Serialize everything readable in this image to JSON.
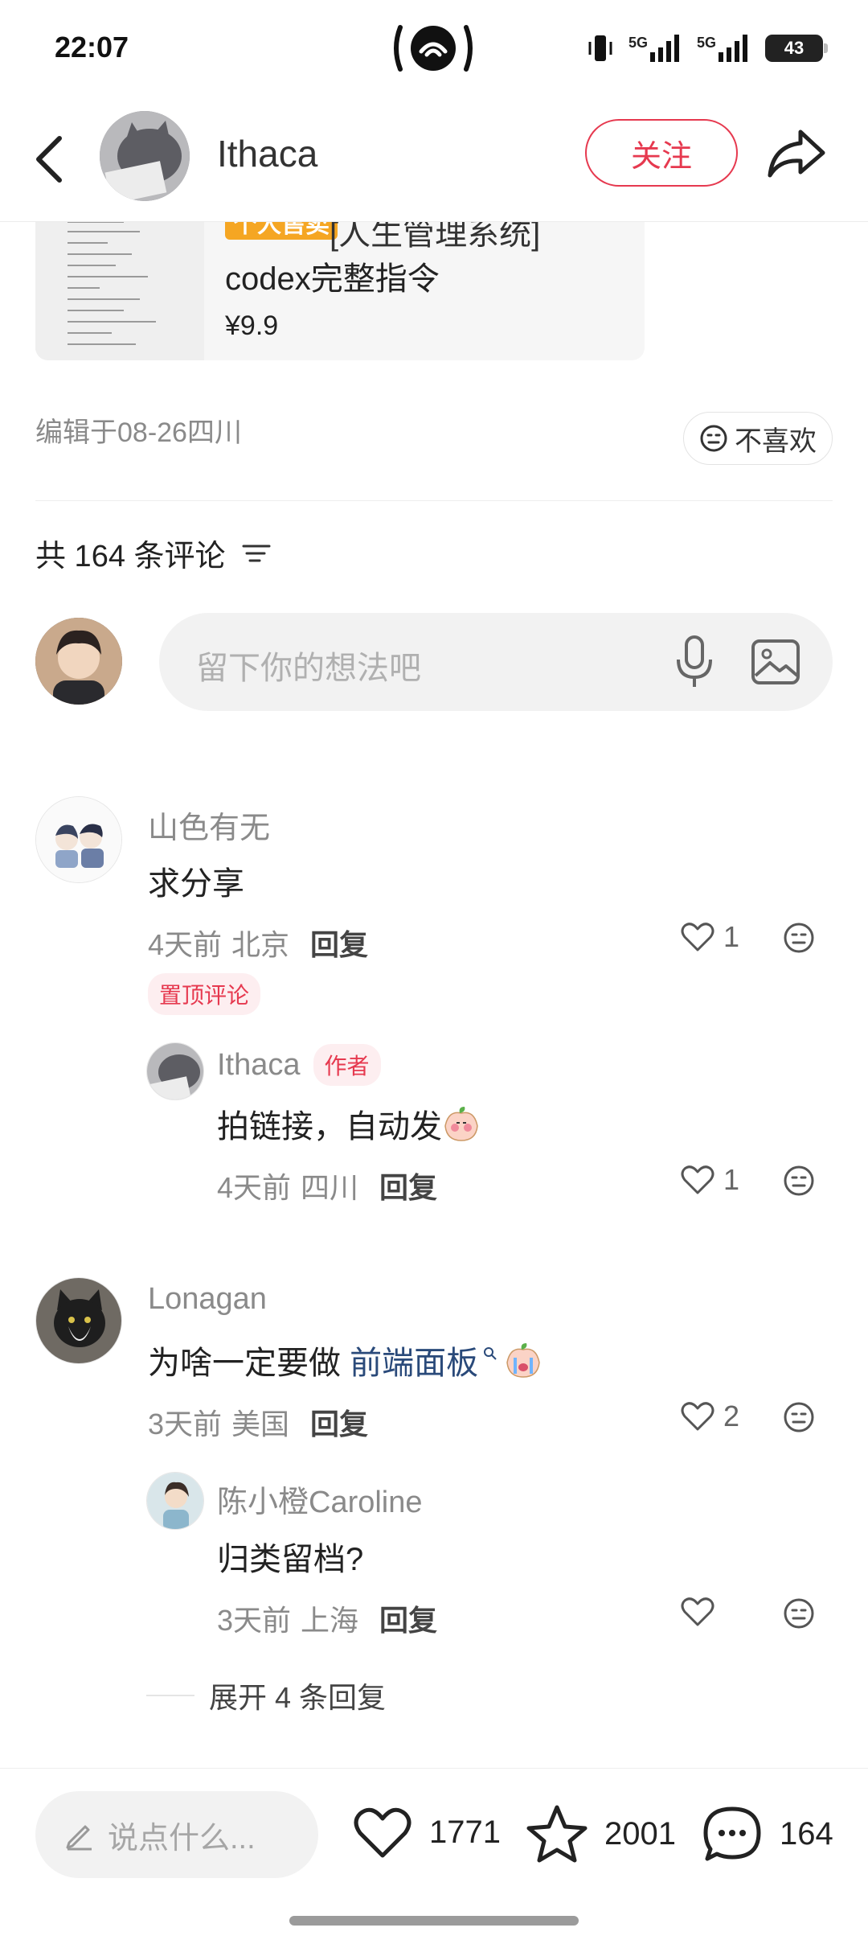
{
  "status_bar": {
    "time": "22:07",
    "network_1": "5G",
    "network_2": "5G",
    "battery": "43"
  },
  "header": {
    "author_name": "Ithaca",
    "follow_label": "关注",
    "icons": [
      "back-arrow-icon",
      "share-icon"
    ]
  },
  "product": {
    "badge": "个人售卖",
    "title_line1": "[人生管理系统]",
    "title_line2": "codex完整指令",
    "price": "¥9.9"
  },
  "post_meta": {
    "edited": "编辑于08-26四川",
    "dislike_label": "不喜欢"
  },
  "comments_section": {
    "count_label": "共 164 条评论",
    "input_placeholder": "留下你的想法吧"
  },
  "comments": [
    {
      "name": "山色有无",
      "text": "求分享",
      "time": "4天前",
      "location": "北京",
      "reply_label": "回复",
      "likes": "1",
      "pinned_label": "置顶评论",
      "replies": [
        {
          "name": "Ithaca",
          "author_badge": "作者",
          "text": "拍链接，自动发",
          "time": "4天前",
          "location": "四川",
          "reply_label": "回复",
          "likes": "1"
        }
      ]
    },
    {
      "name": "Lonagan",
      "text_prefix": "为啥一定要做 ",
      "link_text": "前端面板",
      "time": "3天前",
      "location": "美国",
      "reply_label": "回复",
      "likes": "2",
      "replies": [
        {
          "name": "陈小橙Caroline",
          "text": "归类留档?",
          "time": "3天前",
          "location": "上海",
          "reply_label": "回复",
          "likes": ""
        }
      ],
      "expand_label": "展开 4 条回复"
    }
  ],
  "bottom_bar": {
    "say_placeholder": "说点什么...",
    "likes": "1771",
    "favorites": "2001",
    "comments": "164"
  },
  "colors": {
    "accent": "#e6394f",
    "link": "#2a4a7a",
    "muted": "#8a8a8a"
  }
}
